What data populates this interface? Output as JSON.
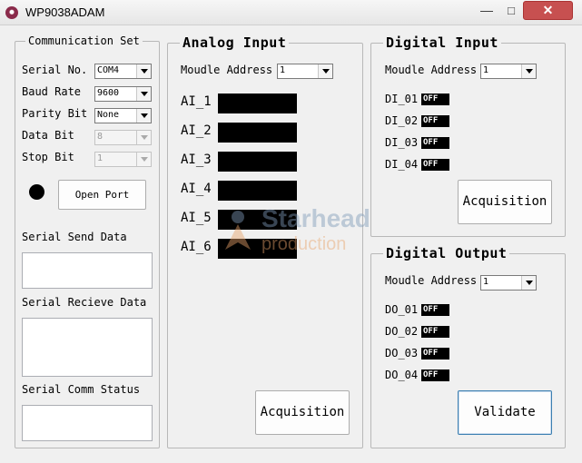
{
  "window": {
    "title": "WP9038ADAM",
    "minimize_label": "—",
    "maximize_label": "□",
    "close_label": "✕"
  },
  "comm": {
    "group_label": "Communication Set",
    "serial_no_label": "Serial No.",
    "serial_no_value": "COM4",
    "baud_rate_label": "Baud Rate",
    "baud_rate_value": "9600",
    "parity_bit_label": "Parity Bit",
    "parity_bit_value": "None",
    "data_bit_label": "Data Bit",
    "data_bit_value": "8",
    "stop_bit_label": "Stop Bit",
    "stop_bit_value": "1",
    "open_port_label": "Open Port",
    "send_data_label": "Serial Send Data",
    "recieve_data_label": "Serial Recieve Data",
    "comm_status_label": "Serial Comm Status",
    "status_led_color": "#000000"
  },
  "analog_input": {
    "group_label": "Analog Input",
    "address_label": "Moudle Address",
    "address_value": "1",
    "channels": [
      "AI_1",
      "AI_2",
      "AI_3",
      "AI_4",
      "AI_5",
      "AI_6"
    ],
    "acquisition_label": "Acquisition"
  },
  "digital_input": {
    "group_label": "Digital Input",
    "address_label": "Moudle Address",
    "address_value": "1",
    "channels": [
      {
        "label": "DI_01",
        "state": "OFF"
      },
      {
        "label": "DI_02",
        "state": "OFF"
      },
      {
        "label": "DI_03",
        "state": "OFF"
      },
      {
        "label": "DI_04",
        "state": "OFF"
      }
    ],
    "acquisition_label": "Acquisition"
  },
  "digital_output": {
    "group_label": "Digital Output",
    "address_label": "Moudle Address",
    "address_value": "1",
    "channels": [
      {
        "label": "DO_01",
        "state": "OFF"
      },
      {
        "label": "DO_02",
        "state": "OFF"
      },
      {
        "label": "DO_03",
        "state": "OFF"
      },
      {
        "label": "DO_04",
        "state": "OFF"
      }
    ],
    "validate_label": "Validate"
  },
  "watermark": {
    "line1": "Starhead",
    "line2": "production"
  }
}
